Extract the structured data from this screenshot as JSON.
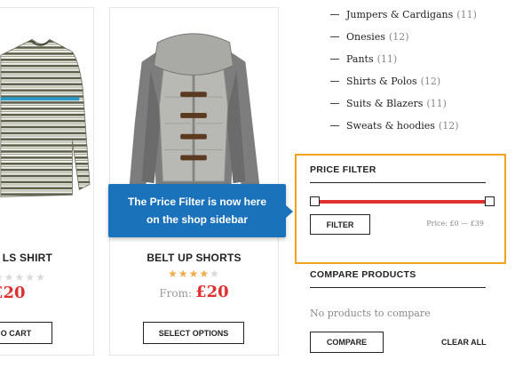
{
  "products": [
    {
      "name": "S LS SHIRT",
      "rating": 0,
      "rating_max": 5,
      "from_label": "",
      "price": "£20",
      "button": "O CART"
    },
    {
      "name": "BELT UP SHORTS",
      "rating": 4,
      "rating_max": 5,
      "from_label": "From:",
      "price": "£20",
      "button": "SELECT OPTIONS"
    }
  ],
  "tooltip": {
    "line1": "The Price Filter is now here",
    "line2": "on the shop sidebar"
  },
  "categories": [
    {
      "name": "Jumpers & Cardigans",
      "count": "(11)"
    },
    {
      "name": "Onesies",
      "count": "(12)"
    },
    {
      "name": "Pants",
      "count": "(11)"
    },
    {
      "name": "Shirts & Polos",
      "count": "(12)"
    },
    {
      "name": "Suits & Blazers",
      "count": "(11)"
    },
    {
      "name": "Sweats & hoodies",
      "count": "(12)"
    }
  ],
  "price_filter": {
    "title": "PRICE FILTER",
    "button": "FILTER",
    "range_text": "Price: £0 — £39",
    "min_value": 0,
    "max_value": 39,
    "highlight_color": "#f3a21a",
    "slider_color": "#e03131"
  },
  "compare": {
    "title": "COMPARE PRODUCTS",
    "empty_text": "No products to compare",
    "compare_button": "COMPARE",
    "clear_all": "CLEAR ALL"
  },
  "colors": {
    "accent_price": "#e03131",
    "tooltip_bg": "#1a73ba",
    "star": "#f0ad4e"
  }
}
